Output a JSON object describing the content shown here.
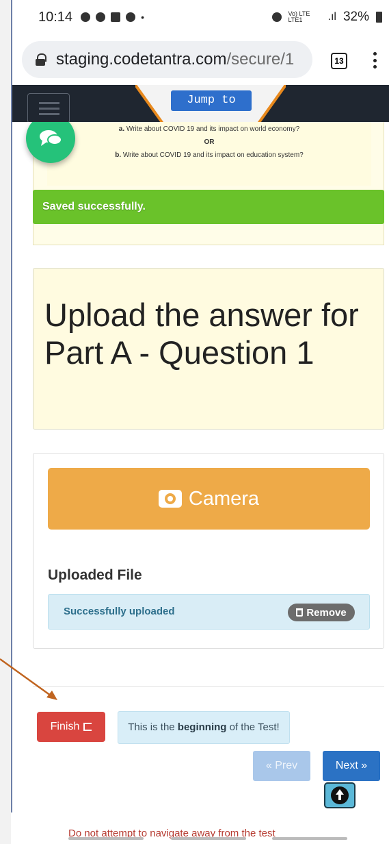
{
  "status_bar": {
    "time": "10:14",
    "network": "Vo) LTE LTE1",
    "battery": "32%"
  },
  "browser": {
    "url_host": "staging.codetantra.com",
    "url_path": "/secure/1",
    "tab_count": "13"
  },
  "topnav": {
    "jump_label": "Jump to"
  },
  "question": {
    "item_a_label": "a.",
    "item_a_text": "Write about COVID 19 and its impact on world economy?",
    "or_text": "OR",
    "item_b_label": "b.",
    "item_b_text": "Write about COVID 19 and its impact on education system?"
  },
  "toast": {
    "message": "Saved successfully."
  },
  "upload": {
    "title": "Upload the answer for Part A - Question 1",
    "camera_label": "Camera",
    "uploaded_heading": "Uploaded File",
    "status_message": "Successfully uploaded",
    "remove_label": "Remove"
  },
  "footer": {
    "finish_label": "Finish",
    "info_prefix": "This is the ",
    "info_bold": "beginning",
    "info_suffix": " of the Test!",
    "prev_label": "« Prev",
    "next_label": "Next »",
    "warning": "Do not attempt to navigate away from the test"
  },
  "colors": {
    "toast_green": "#6ac22a",
    "camera_orange": "#eeaa48",
    "finish_red": "#d9453f",
    "next_blue": "#2b72c4",
    "chat_green": "#25c27a",
    "annotation_arrow": "#c0641f"
  }
}
